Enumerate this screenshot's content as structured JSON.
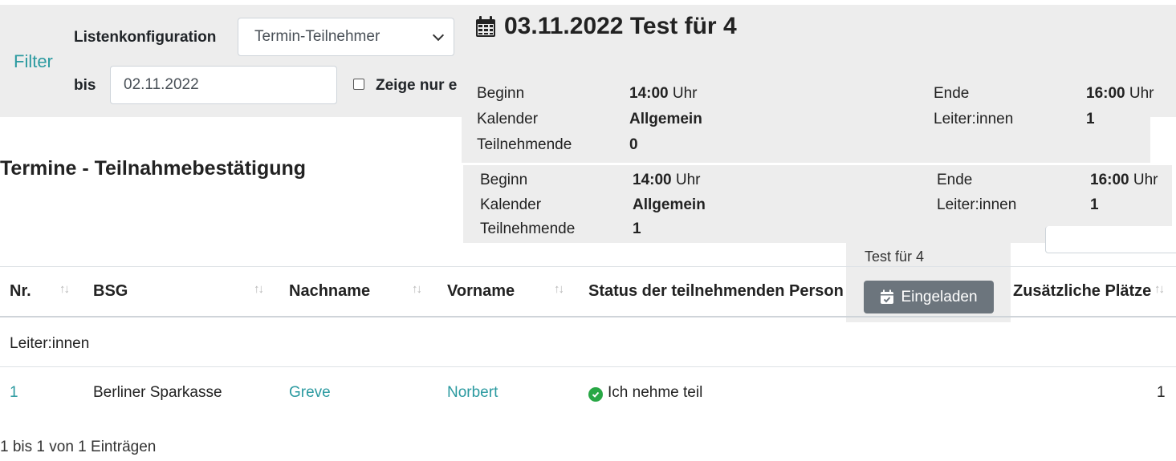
{
  "filter": {
    "toggle_label": "Filter",
    "list_config_label": "Listenkonfiguration",
    "list_config_value": "Termin-Teilnehmer",
    "bis_label": "bis",
    "bis_value": "02.11.2022",
    "checkbox_label": "Zeige nur e"
  },
  "popover": {
    "title": "03.11.2022 Test für 4",
    "blocks": [
      {
        "beginn_label": "Beginn",
        "beginn_time": "14:00",
        "beginn_unit": "Uhr",
        "ende_label": "Ende",
        "ende_time": "16:00",
        "ende_unit": "Uhr",
        "kalender_label": "Kalender",
        "kalender_value": "Allgemein",
        "leiter_label": "Leiter:innen",
        "leiter_value": "1",
        "teilnehmende_label": "Teilnehmende",
        "teilnehmende_value": "0"
      },
      {
        "beginn_label": "Beginn",
        "beginn_time": "14:00",
        "beginn_unit": "Uhr",
        "ende_label": "Ende",
        "ende_time": "16:00",
        "ende_unit": "Uhr",
        "kalender_label": "Kalender",
        "kalender_value": "Allgemein",
        "leiter_label": "Leiter:innen",
        "leiter_value": "1",
        "teilnehmende_label": "Teilnehmende",
        "teilnehmende_value": "1"
      }
    ]
  },
  "page_title": "Termine - Teilnahmebestätigung",
  "small_popover": {
    "title": "Test für 4",
    "button_label": "Eingeladen"
  },
  "table": {
    "headers": [
      "Nr.",
      "BSG",
      "Nachname",
      "Vorname",
      "Status der teilnehmenden Person",
      "Zusätzliche Plätze"
    ],
    "group_label": "Leiter:innen",
    "rows": [
      {
        "nr": "1",
        "bsg": "Berliner Sparkasse",
        "nachname": "Greve",
        "vorname": "Norbert",
        "status": "Ich nehme teil",
        "plaetze": "1"
      }
    ]
  },
  "footer": "1 bis 1 von 1 Einträgen",
  "colors": {
    "accent": "#2b9aa0",
    "success": "#28a745",
    "button": "#6c757d",
    "panel": "#ededed"
  }
}
